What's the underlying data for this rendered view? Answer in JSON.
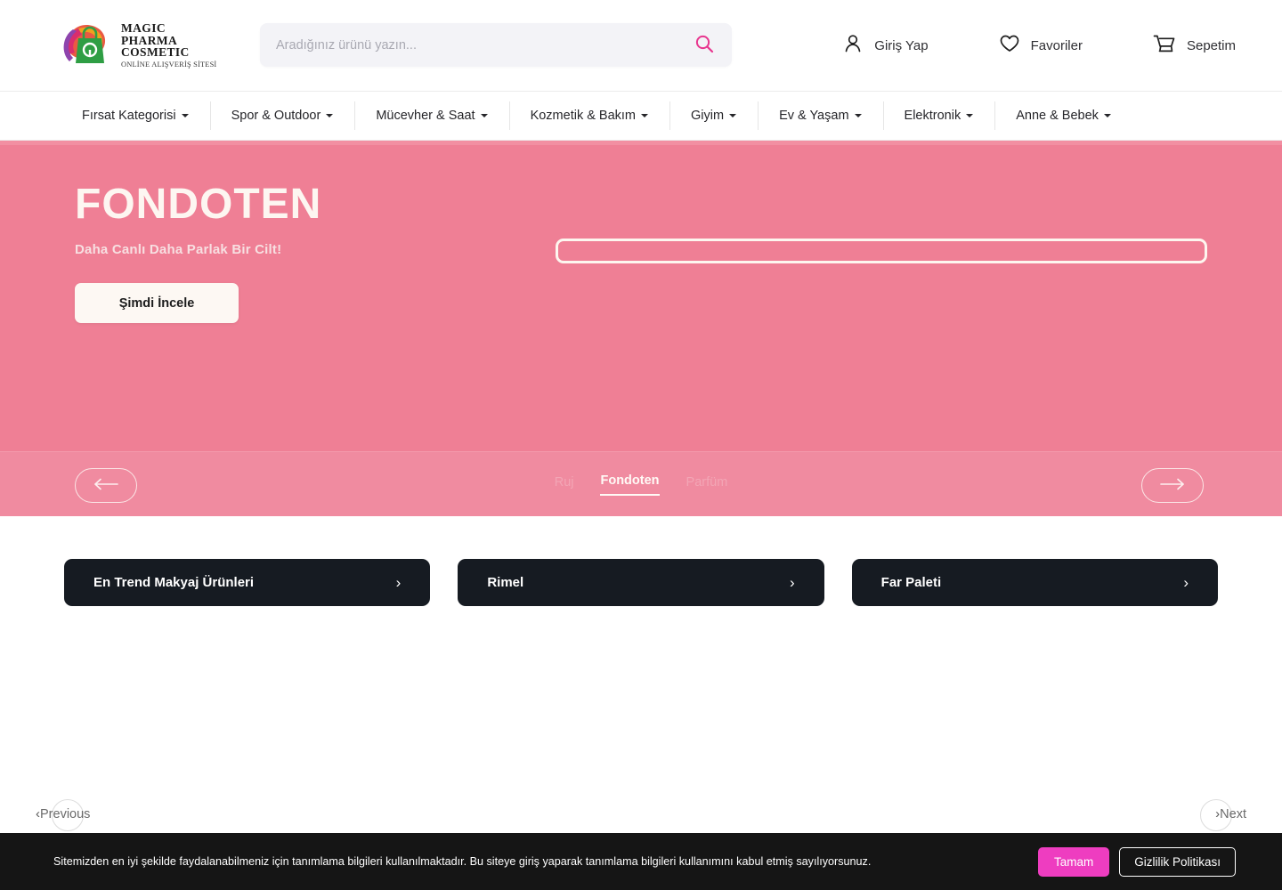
{
  "brand": {
    "logo_line1": "MAGIC",
    "logo_line2": "PHARMA",
    "logo_line3": "COSMETIC",
    "logo_sub": "ONLİNE ALIŞVERİŞ SİTESİ",
    "accent_pink": "#ee3dc0",
    "hero_pink": "#ef7f95",
    "carousel_pink": "#f08ba0",
    "card_dark": "#161b22"
  },
  "search": {
    "placeholder": "Aradığınız ürünü yazın...",
    "value": "",
    "icon": "search-icon"
  },
  "header": {
    "actions": [
      {
        "label": "Giriş Yap",
        "icon": "user-icon"
      },
      {
        "label": "Favoriler",
        "icon": "heart-icon"
      },
      {
        "label": "Sepetim",
        "icon": "cart-icon"
      }
    ]
  },
  "nav": {
    "items": [
      {
        "label": "Fırsat Kategorisi",
        "has_dropdown": true
      },
      {
        "label": "Spor & Outdoor",
        "has_dropdown": true
      },
      {
        "label": "Mücevher & Saat",
        "has_dropdown": true
      },
      {
        "label": "Kozmetik & Bakım",
        "has_dropdown": true
      },
      {
        "label": "Giyim",
        "has_dropdown": true
      },
      {
        "label": "Ev & Yaşam",
        "has_dropdown": true
      },
      {
        "label": "Elektronik",
        "has_dropdown": true
      },
      {
        "label": "Anne & Bebek",
        "has_dropdown": true
      }
    ]
  },
  "hero": {
    "title": "FONDOTEN",
    "subtitle": "Daha Canlı Daha Parlak Bir Cilt!",
    "cta_label": "Şimdi İncele"
  },
  "carousel": {
    "prev_icon": "arrow-left-icon",
    "next_icon": "arrow-right-icon",
    "tabs": [
      {
        "label": "Ruj",
        "active": false
      },
      {
        "label": "Fondoten",
        "active": true
      },
      {
        "label": "Parfüm",
        "active": false
      }
    ]
  },
  "category_cards": [
    {
      "label": "En Trend Makyaj Ürünleri",
      "icon": "chevron-right-icon"
    },
    {
      "label": "Rimel",
      "icon": "chevron-right-icon"
    },
    {
      "label": "Far Paleti",
      "icon": "chevron-right-icon"
    }
  ],
  "pager": {
    "previous_label": "Previous",
    "previous_icon": "chevron-left-icon",
    "next_label": "Next",
    "next_icon": "chevron-right-icon"
  },
  "cookie": {
    "text": "Sitemizden en iyi şekilde faydalanabilmeniz için tanımlama bilgileri kullanılmaktadır. Bu siteye giriş yaparak tanımlama bilgileri kullanımını kabul etmiş sayılıyorsunuz.",
    "accept_label": "Tamam",
    "policy_label": "Gizlilik Politikası"
  }
}
